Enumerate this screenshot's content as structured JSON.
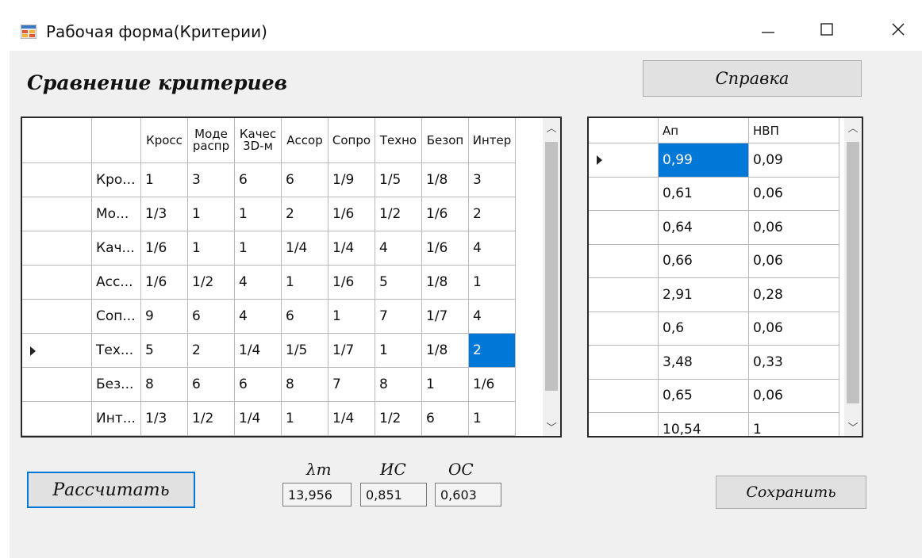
{
  "colors": {
    "accent": "#0078d7",
    "window_bg": "#f0f0f0",
    "grid_bg": "#ffffff",
    "button_bg": "#e1e1e1"
  },
  "window": {
    "title": "Рабочая форма(Критерии)",
    "icons": {
      "app": "app-form-icon",
      "minimize": "minimize-icon",
      "maximize": "maximize-icon",
      "close": "close-icon"
    }
  },
  "form": {
    "heading": "Сравнение критериев",
    "help_button": "Справка",
    "calc_button": "Рассчитать",
    "save_button": "Сохранить"
  },
  "criteria_grid": {
    "headers": [
      [
        "Кросс"
      ],
      [
        "Моде",
        "распр"
      ],
      [
        "Качес",
        "3D-м"
      ],
      [
        "Ассор"
      ],
      [
        "Сопро"
      ],
      [
        "Техно"
      ],
      [
        "Безоп"
      ],
      [
        "Интер"
      ]
    ],
    "row_labels": [
      "Кро...",
      "Мо...",
      "Кач...",
      "Асс...",
      "Соп...",
      "Тех...",
      "Без...",
      "Инт..."
    ],
    "rows": [
      [
        "1",
        "3",
        "6",
        "6",
        "1/9",
        "1/5",
        "1/8",
        "3"
      ],
      [
        "1/3",
        "1",
        "1",
        "2",
        "1/6",
        "1/2",
        "1/6",
        "2"
      ],
      [
        "1/6",
        "1",
        "1",
        "1/4",
        "1/4",
        "4",
        "1/6",
        "4"
      ],
      [
        "1/6",
        "1/2",
        "4",
        "1",
        "1/6",
        "5",
        "1/8",
        "1"
      ],
      [
        "9",
        "6",
        "4",
        "6",
        "1",
        "7",
        "1/7",
        "4"
      ],
      [
        "5",
        "2",
        "1/4",
        "1/5",
        "1/7",
        "1",
        "1/8",
        "2"
      ],
      [
        "8",
        "6",
        "6",
        "8",
        "7",
        "8",
        "1",
        "1/6"
      ],
      [
        "1/3",
        "1/2",
        "1/4",
        "1",
        "1/4",
        "1/2",
        "6",
        "1"
      ]
    ],
    "selected_row": 5,
    "selected_col": 7
  },
  "weights_grid": {
    "headers": [
      "Ап",
      "НВП"
    ],
    "rows": [
      [
        "0,99",
        "0,09"
      ],
      [
        "0,61",
        "0,06"
      ],
      [
        "0,64",
        "0,06"
      ],
      [
        "0,66",
        "0,06"
      ],
      [
        "2,91",
        "0,28"
      ],
      [
        "0,6",
        "0,06"
      ],
      [
        "3,48",
        "0,33"
      ],
      [
        "0,65",
        "0,06"
      ],
      [
        "10,54",
        "1"
      ]
    ],
    "selected_row": 0,
    "selected_col": 0
  },
  "results": {
    "lambda_label": "λт",
    "lambda_value": "13,956",
    "ci_label": "ИС",
    "ci_value": "0,851",
    "cr_label": "ОС",
    "cr_value": "0,603"
  }
}
